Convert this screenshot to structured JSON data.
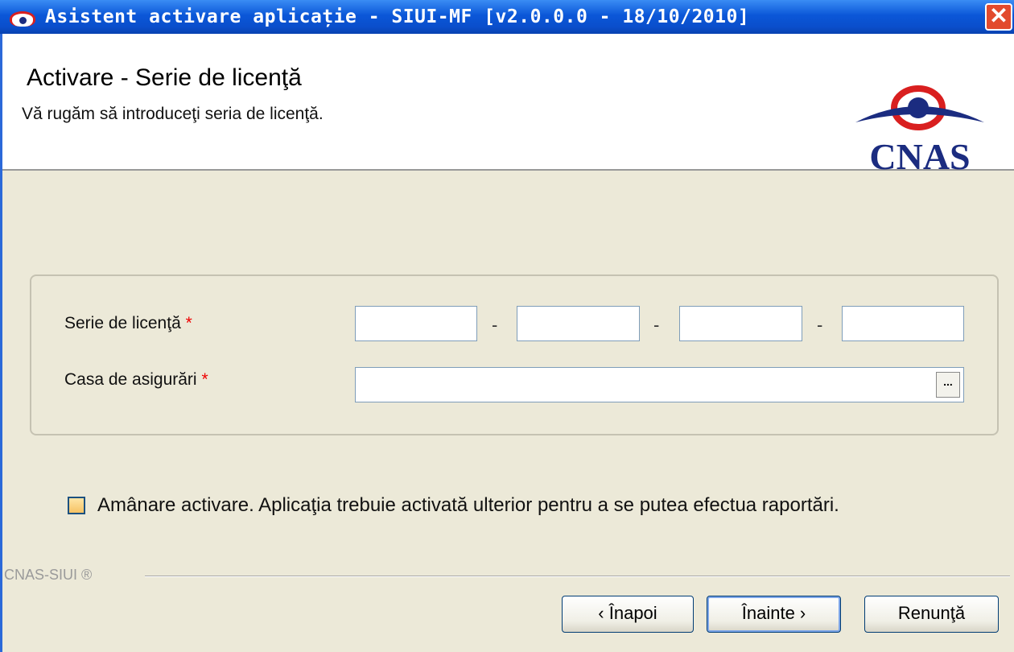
{
  "window": {
    "title": "Asistent activare aplicație - SIUI-MF [v2.0.0.0 - 18/10/2010]",
    "close_label": "✕"
  },
  "header": {
    "title": "Activare - Serie de licenţă",
    "subtitle": "Vă rugăm să introduceţi seria de licenţă.",
    "logo_text": "CNAS"
  },
  "form": {
    "serie_label": "Serie de licenţă",
    "casa_label": "Casa de asigurări",
    "required_mark": "*",
    "separator": "-",
    "serie_values": [
      "",
      "",
      "",
      ""
    ],
    "casa_value": "",
    "browse_label": "..."
  },
  "postpone": {
    "checked": false,
    "label": "Amânare activare. Aplicaţia trebuie activată ulterior pentru a se putea efectua raportări."
  },
  "footer": {
    "brand": "CNAS-SIUI ®",
    "back_label": "‹ Înapoi",
    "next_label": "Înainte ›",
    "cancel_label": "Renunţă"
  },
  "colors": {
    "titlebar": "#0a4ecb",
    "logo_red": "#d91f1f",
    "logo_navy": "#1b2c80",
    "required": "#e00000"
  },
  "icons": [
    "app-eye-icon",
    "close-icon",
    "cnas-logo"
  ]
}
